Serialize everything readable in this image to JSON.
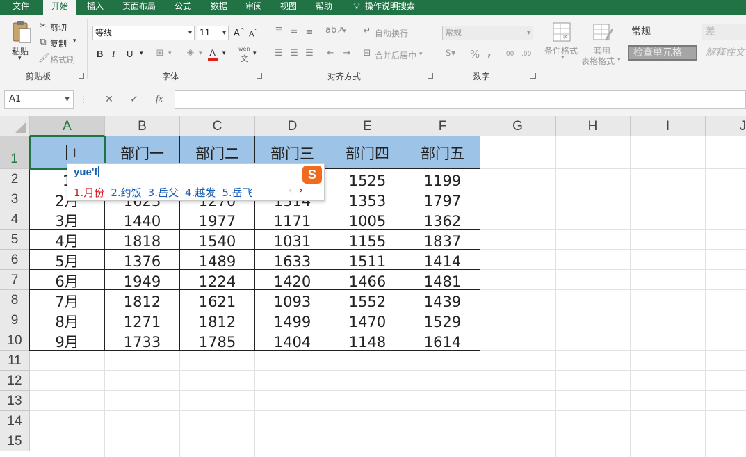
{
  "menu": {
    "tabs": [
      {
        "label": "文件"
      },
      {
        "label": "开始"
      },
      {
        "label": "插入"
      },
      {
        "label": "页面布局"
      },
      {
        "label": "公式"
      },
      {
        "label": "数据"
      },
      {
        "label": "审阅"
      },
      {
        "label": "视图"
      },
      {
        "label": "帮助"
      }
    ],
    "active_tab": "开始",
    "tell_me": "操作说明搜索"
  },
  "ribbon": {
    "clipboard": {
      "label": "剪贴板",
      "paste": "粘贴",
      "cut": "剪切",
      "copy": "复制",
      "format_painter": "格式刷"
    },
    "font": {
      "label": "字体",
      "font_name": "等线",
      "font_size": "11",
      "bold": "B",
      "italic": "I",
      "underline": "U",
      "font_color_letter": "A",
      "phonetic_top": "wén",
      "phonetic_bottom": "文"
    },
    "alignment": {
      "label": "对齐方式",
      "wrap_text": "自动换行",
      "merge_center": "合并后居中"
    },
    "number": {
      "label": "数字",
      "format": "常规",
      "percent": "%",
      "comma": ",",
      "inc_decimal": ".00",
      "dec_decimal": ".00"
    },
    "styles": {
      "conditional_format": "条件格式",
      "format_as_table_1": "套用",
      "format_as_table_2": "表格格式",
      "style_normal": "常规",
      "style_bad": "差",
      "style_check_cell": "检查单元格",
      "style_explanatory": "解释性文"
    }
  },
  "formula_bar": {
    "name_box": "A1",
    "cancel": "✕",
    "enter": "✓",
    "fx": "fx",
    "value": ""
  },
  "sheet": {
    "columns": [
      "A",
      "B",
      "C",
      "D",
      "E",
      "F",
      "G",
      "H",
      "I",
      "J"
    ],
    "rows": [
      "1",
      "2",
      "3",
      "4",
      "5",
      "6",
      "7",
      "8",
      "9",
      "10",
      "11",
      "12",
      "13",
      "14",
      "15"
    ],
    "active_cell": "A1",
    "table": {
      "headers": [
        "",
        "部门一",
        "部门二",
        "部门三",
        "部门四",
        "部门五"
      ],
      "data": [
        [
          "1",
          "",
          "",
          "",
          "1525",
          "1199"
        ],
        [
          "2月",
          "1623",
          "1270",
          "1314",
          "1353",
          "1797"
        ],
        [
          "3月",
          "1440",
          "1977",
          "1171",
          "1005",
          "1362"
        ],
        [
          "4月",
          "1818",
          "1540",
          "1031",
          "1155",
          "1837"
        ],
        [
          "5月",
          "1376",
          "1489",
          "1633",
          "1511",
          "1414"
        ],
        [
          "6月",
          "1949",
          "1224",
          "1420",
          "1466",
          "1481"
        ],
        [
          "7月",
          "1812",
          "1621",
          "1093",
          "1552",
          "1439"
        ],
        [
          "8月",
          "1271",
          "1812",
          "1499",
          "1470",
          "1529"
        ],
        [
          "9月",
          "1733",
          "1785",
          "1404",
          "1148",
          "1614"
        ]
      ],
      "header_fill": "#9dc3e6"
    }
  },
  "ime": {
    "composition": "yue'f",
    "logo_letter": "S",
    "candidates": [
      {
        "num": "1.",
        "text": "月份"
      },
      {
        "num": "2.",
        "text": "约饭"
      },
      {
        "num": "3.",
        "text": "岳父"
      },
      {
        "num": "4.",
        "text": "越发"
      },
      {
        "num": "5.",
        "text": "岳飞"
      }
    ],
    "prev": "‹",
    "next": "›"
  },
  "colors": {
    "excel_green": "#217346",
    "ribbon_bg": "#f3f3f3",
    "ime_accent": "#f06b1e"
  }
}
